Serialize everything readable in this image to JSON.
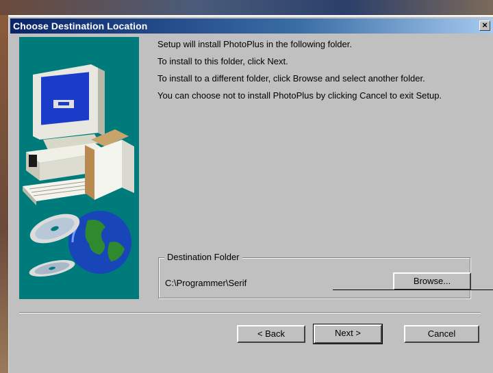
{
  "window": {
    "title": "Choose Destination Location",
    "close_glyph": "×"
  },
  "messages": [
    "Setup will install PhotoPlus in the following folder.",
    "To install to this folder, click Next.",
    "To install to a different folder, click Browse and select another folder.",
    "You can choose not to install PhotoPlus by clicking Cancel to exit Setup."
  ],
  "destination": {
    "legend": "Destination Folder",
    "path": "C:\\Programmer\\Serif",
    "browse_label": "Browse..."
  },
  "buttons": {
    "back": "< Back",
    "next": "Next >",
    "cancel": "Cancel"
  },
  "icons": {
    "art": "computer-and-globe-illustration",
    "close": "close-icon"
  },
  "colors": {
    "title_bar_start": "#0a246a",
    "title_bar_end": "#a6caf0",
    "dialog_bg": "#c0c0c0",
    "art_bg": "#007b7b"
  }
}
